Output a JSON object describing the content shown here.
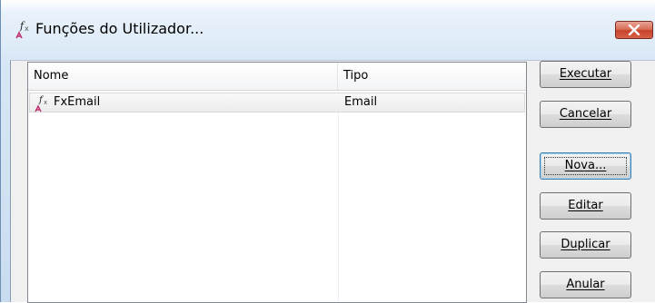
{
  "window": {
    "title": "Funções do Utilizador...",
    "icon": "function-fx-icon",
    "close_icon": "close-x-icon",
    "accent": "#c7412a"
  },
  "list": {
    "columns": [
      "Nome",
      "Tipo"
    ],
    "rows": [
      {
        "name": "FxEmail",
        "type": "Email",
        "icon": "function-fx-icon"
      }
    ]
  },
  "buttons": {
    "executar": "Executar",
    "cancelar": "Cancelar",
    "nova": "Nova...",
    "editar": "Editar",
    "duplicar": "Duplicar",
    "anular": "Anular"
  }
}
